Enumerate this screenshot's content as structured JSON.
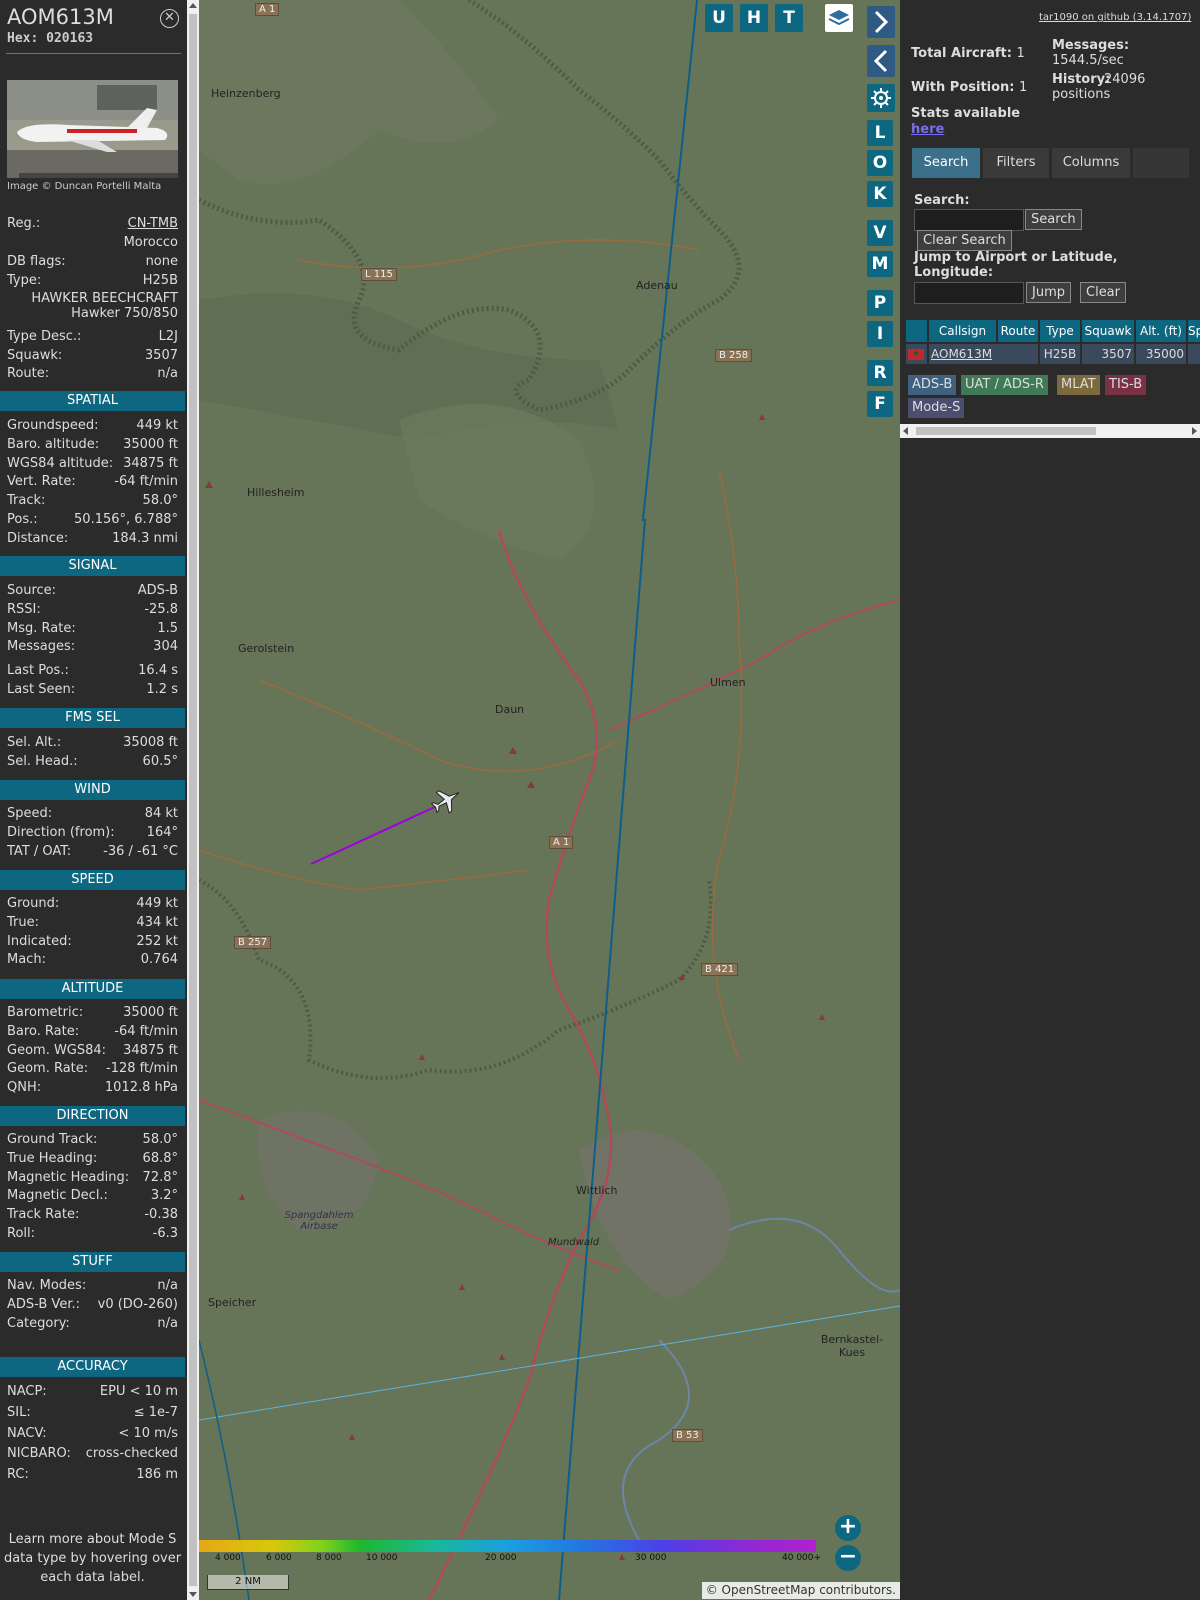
{
  "info": {
    "callsign": "AOM613M",
    "hex": "Hex: 020163",
    "close_icon": "close-icon",
    "image_credit": "Image © Duncan Portelli Malta",
    "details": [
      {
        "k": "Reg.:",
        "v": "CN-TMB"
      },
      {
        "k": "",
        "v": "Morocco"
      },
      {
        "k": "DB flags:",
        "v": "none"
      },
      {
        "k": "Type:",
        "v": "H25B"
      },
      {
        "k": "",
        "v": "HAWKER BEECHCRAFT"
      },
      {
        "k": "",
        "v": "Hawker 750/850"
      },
      {
        "k": "Type Desc.:",
        "v": "L2J"
      },
      {
        "k": "Squawk:",
        "v": "3507"
      },
      {
        "k": "Route:",
        "v": "n/a"
      }
    ],
    "sections": {
      "spatial": "SPATIAL",
      "signal": "SIGNAL",
      "fms": "FMS SEL",
      "wind": "WIND",
      "speed": "SPEED",
      "altitude": "ALTITUDE",
      "direction": "DIRECTION",
      "stuff": "STUFF",
      "accuracy": "ACCURACY"
    },
    "spatial": [
      {
        "k": "Groundspeed:",
        "v": "449 kt"
      },
      {
        "k": "Baro. altitude:",
        "v": "35000 ft"
      },
      {
        "k": "WGS84 altitude:",
        "v": "34875 ft"
      },
      {
        "k": "Vert. Rate:",
        "v": "-64 ft/min"
      },
      {
        "k": "Track:",
        "v": "58.0°"
      },
      {
        "k": "Pos.:",
        "v": "50.156°, 6.788°"
      },
      {
        "k": "Distance:",
        "v": "184.3 nmi"
      }
    ],
    "signal": [
      {
        "k": "Source:",
        "v": "ADS-B"
      },
      {
        "k": "RSSI:",
        "v": "-25.8"
      },
      {
        "k": "Msg. Rate:",
        "v": "1.5"
      },
      {
        "k": "Messages:",
        "v": "304"
      },
      {
        "k": "Last Pos.:",
        "v": "16.4 s"
      },
      {
        "k": "Last Seen:",
        "v": "1.2 s"
      }
    ],
    "fms": [
      {
        "k": "Sel. Alt.:",
        "v": "35008 ft"
      },
      {
        "k": "Sel. Head.:",
        "v": "60.5°"
      }
    ],
    "wind": [
      {
        "k": "Speed:",
        "v": "84 kt"
      },
      {
        "k": "Direction (from):",
        "v": "164°"
      },
      {
        "k": "TAT / OAT:",
        "v": "-36 / -61 °C"
      }
    ],
    "speed": [
      {
        "k": "Ground:",
        "v": "449 kt"
      },
      {
        "k": "True:",
        "v": "434 kt"
      },
      {
        "k": "Indicated:",
        "v": "252 kt"
      },
      {
        "k": "Mach:",
        "v": "0.764"
      }
    ],
    "altitude": [
      {
        "k": "Barometric:",
        "v": "35000 ft"
      },
      {
        "k": "Baro. Rate:",
        "v": "-64 ft/min"
      },
      {
        "k": "Geom. WGS84:",
        "v": "34875 ft"
      },
      {
        "k": "Geom. Rate:",
        "v": "-128 ft/min"
      },
      {
        "k": "QNH:",
        "v": "1012.8 hPa"
      }
    ],
    "direction": [
      {
        "k": "Ground Track:",
        "v": "58.0°"
      },
      {
        "k": "True Heading:",
        "v": "68.8°"
      },
      {
        "k": "Magnetic Heading:",
        "v": "72.8°"
      },
      {
        "k": "Magnetic Decl.:",
        "v": "3.2°"
      },
      {
        "k": "Track Rate:",
        "v": "-0.38"
      },
      {
        "k": "Roll:",
        "v": "-6.3"
      }
    ],
    "stuff": [
      {
        "k": "Nav. Modes:",
        "v": "n/a"
      },
      {
        "k": "ADS-B Ver.:",
        "v": "v0 (DO-260)"
      },
      {
        "k": "Category:",
        "v": "n/a"
      }
    ],
    "accuracy": [
      {
        "k": "NACP:",
        "v": "EPU < 10 m"
      },
      {
        "k": "SIL:",
        "v": "≤ 1e-7"
      },
      {
        "k": "NACV:",
        "v": "< 10 m/s"
      },
      {
        "k": "NICBARO:",
        "v": "cross-checked"
      },
      {
        "k": "RC:",
        "v": "186 m"
      }
    ],
    "footer": "Learn more about Mode S data type by hovering over each data label."
  },
  "map": {
    "places": [
      {
        "name": "Heinzenberg"
      },
      {
        "name": "Adenau"
      },
      {
        "name": "Hillesheim"
      },
      {
        "name": "Gerolstein"
      },
      {
        "name": "Daun"
      },
      {
        "name": "Ulmen"
      },
      {
        "name": "Wittlich"
      },
      {
        "name": "Spangdahlem Airbase"
      },
      {
        "name": "Speicher"
      },
      {
        "name": "Bernkastel-Kues"
      },
      {
        "name": "Mundwald"
      }
    ],
    "road_badges": [
      "A 1",
      "L 115",
      "B 258",
      "A 1",
      "B 257",
      "B 421",
      "B 53"
    ],
    "controls": [
      "U",
      "H",
      "T"
    ],
    "side_buttons": [
      "L",
      "O",
      "K",
      "V",
      "M",
      "P",
      "I",
      "R",
      "F"
    ],
    "layers_icon": "layers-icon",
    "settings_icon": "gear-icon",
    "colorbar_labels": [
      "4 000",
      "6 000",
      "8 000",
      "10 000",
      "20 000",
      "30 000",
      "40 000+"
    ],
    "scale_label": "2 NM",
    "attribution": "© OpenStreetMap contributors."
  },
  "right": {
    "github_link": "tar1090 on github (3.14.1707)",
    "total_aircraft_label": "Total Aircraft:",
    "total_aircraft": "1",
    "with_position_label": "With Position:",
    "with_position": "1",
    "stats_label": "Stats available",
    "stats_link": "here",
    "messages_label": "Messages:",
    "messages_value": "1544.5/sec",
    "history_label": "History:",
    "history_value": "24096 positions",
    "tabs": [
      "Search",
      "Filters",
      "Columns"
    ],
    "search_label": "Search:",
    "search_button": "Search",
    "clear_search_button": "Clear Search",
    "jump_label": "Jump to Airport or Latitude, Longitude:",
    "jump_button": "Jump",
    "clear_button": "Clear",
    "table_headers": [
      "",
      "Callsign",
      "Route",
      "Type",
      "Squawk",
      "Alt. (ft)",
      "Sp"
    ],
    "table_row": {
      "callsign": "AOM613M",
      "route": "",
      "type": "H25B",
      "squawk": "3507",
      "alt": "35000"
    },
    "legend": [
      {
        "label": "ADS-B",
        "color": "#3e6180"
      },
      {
        "label": "UAT / ADS-R",
        "color": "#3d7a55"
      },
      {
        "label": "MLAT",
        "color": "#7a6a3d"
      },
      {
        "label": "TIS-B",
        "color": "#7a3045"
      },
      {
        "label": "Mode-S",
        "color": "#4a4f70"
      }
    ]
  }
}
